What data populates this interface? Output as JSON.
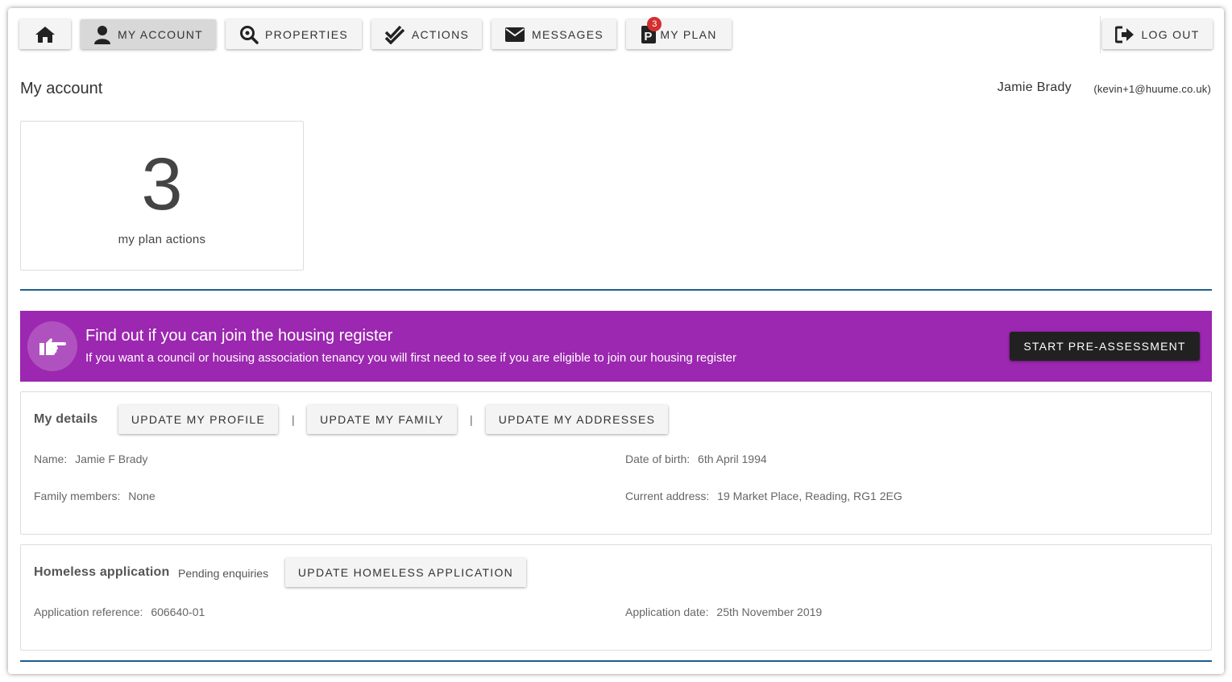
{
  "nav": {
    "home_icon": "home-icon",
    "items": [
      {
        "label": "MY ACCOUNT",
        "icon": "user-icon",
        "active": true
      },
      {
        "label": "PROPERTIES",
        "icon": "search-icon"
      },
      {
        "label": "ACTIONS",
        "icon": "double-check-icon"
      },
      {
        "label": "MESSAGES",
        "icon": "envelope-icon"
      },
      {
        "label": "MY PLAN",
        "icon": "plan-p-icon",
        "badge": "3"
      }
    ],
    "logout_label": "LOG OUT",
    "logout_icon": "logout-icon"
  },
  "header": {
    "title": "My account",
    "user_name": "Jamie Brady",
    "user_email": "(kevin+1@huume.co.uk)"
  },
  "stat": {
    "value": "3",
    "label": "my plan actions"
  },
  "banner": {
    "icon": "pointing-hand-icon",
    "title": "Find out if you can join the housing register",
    "subtitle": "If you want a council or housing association tenancy you will first need to see if you are eligible to join our housing register",
    "button": "START PRE-ASSESSMENT",
    "color": "#9c27b0"
  },
  "details": {
    "title": "My details",
    "buttons": [
      "UPDATE MY PROFILE",
      "UPDATE MY FAMILY",
      "UPDATE MY ADDRESSES"
    ],
    "separator": "|",
    "fields": {
      "name_label": "Name:",
      "name_value": "Jamie F Brady",
      "dob_label": "Date of birth:",
      "dob_value": "6th April 1994",
      "family_label": "Family members:",
      "family_value": "None",
      "address_label": "Current address:",
      "address_value": "19 Market Place, Reading, RG1 2EG"
    }
  },
  "homeless": {
    "title": "Homeless application",
    "status": "Pending enquiries",
    "button": "UPDATE HOMELESS APPLICATION",
    "fields": {
      "ref_label": "Application reference:",
      "ref_value": "606640-01",
      "date_label": "Application date:",
      "date_value": "25th November 2019"
    }
  },
  "colors": {
    "accent_rule": "#1f5e8c",
    "badge": "#d32f2f",
    "dark_button": "#212121"
  }
}
